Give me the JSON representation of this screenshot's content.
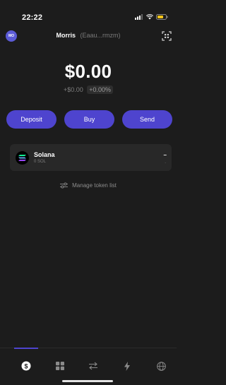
{
  "status_bar": {
    "time": "22:22"
  },
  "header": {
    "avatar_initials": "MO",
    "account_name": "Morris",
    "account_address": "(Eaau...rmzm)"
  },
  "balance": {
    "amount": "$0.00",
    "change_value": "+$0.00",
    "change_percent": "+0.00%"
  },
  "actions": {
    "deposit_label": "Deposit",
    "buy_label": "Buy",
    "send_label": "Send"
  },
  "tokens": [
    {
      "name": "Solana",
      "balance": "0 SOL",
      "value": "–",
      "change": "-"
    }
  ],
  "manage_token_label": "Manage token list",
  "tab_bar": {
    "icons": [
      "dollar-icon",
      "grid-icon",
      "swap-icon",
      "lightning-icon",
      "globe-icon"
    ],
    "active_index": 0
  },
  "colors": {
    "background": "#1c1c1c",
    "accent": "#4e44ce",
    "card": "#282828",
    "muted_text": "#7a7a7a"
  }
}
